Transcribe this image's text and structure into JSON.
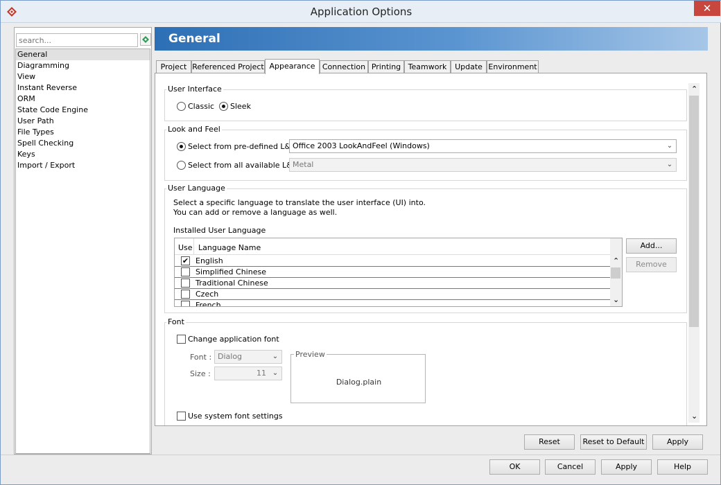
{
  "window": {
    "title": "Application Options",
    "close_glyph": "✕",
    "app_icon": "diamond-logo-icon"
  },
  "sidebar": {
    "search_placeholder": "search...",
    "items": [
      "General",
      "Diagramming",
      "View",
      "Instant Reverse",
      "ORM",
      "State Code Engine",
      "User Path",
      "File Types",
      "Spell Checking",
      "Keys",
      "Import / Export"
    ],
    "selected": "General"
  },
  "header": {
    "title": "General"
  },
  "tabs": [
    "Project",
    "Referenced Project",
    "Appearance",
    "Connection",
    "Printing",
    "Teamwork",
    "Update",
    "Environment"
  ],
  "active_tab": "Appearance",
  "user_interface": {
    "legend": "User Interface",
    "classic_label": "Classic",
    "sleek_label": "Sleek",
    "selected": "Sleek"
  },
  "look_and_feel": {
    "legend": "Look and Feel",
    "predefined_label": "Select from pre-defined L&F:",
    "predefined_value": "Office 2003 LookAndFeel (Windows)",
    "all_label": "Select from all available L&F:",
    "all_value": "Metal",
    "selected": "predefined"
  },
  "user_language": {
    "legend": "User Language",
    "description_line1": "Select a specific language to translate the user interface (UI) into.",
    "description_line2": "You can add or remove a language as well.",
    "installed_label": "Installed User Language",
    "col_use": "Use",
    "col_name": "Language Name",
    "rows": [
      {
        "name": "English",
        "checked": true
      },
      {
        "name": "Simplified Chinese",
        "checked": false
      },
      {
        "name": "Traditional Chinese",
        "checked": false
      },
      {
        "name": "Czech",
        "checked": false
      },
      {
        "name": "French",
        "checked": false
      }
    ],
    "add_label": "Add...",
    "remove_label": "Remove"
  },
  "font": {
    "legend": "Font",
    "change_label": "Change application font",
    "font_label": "Font :",
    "font_value": "Dialog",
    "size_label": "Size :",
    "size_value": "11",
    "preview_legend": "Preview",
    "preview_text": "Dialog.plain",
    "system_label": "Use system font settings"
  },
  "panel_buttons": {
    "reset": "Reset",
    "reset_default": "Reset to Default",
    "apply": "Apply"
  },
  "dialog_buttons": {
    "ok": "OK",
    "cancel": "Cancel",
    "apply": "Apply",
    "help": "Help"
  },
  "glyphs": {
    "down": "⌄",
    "up": "⌃",
    "check": "✔"
  }
}
